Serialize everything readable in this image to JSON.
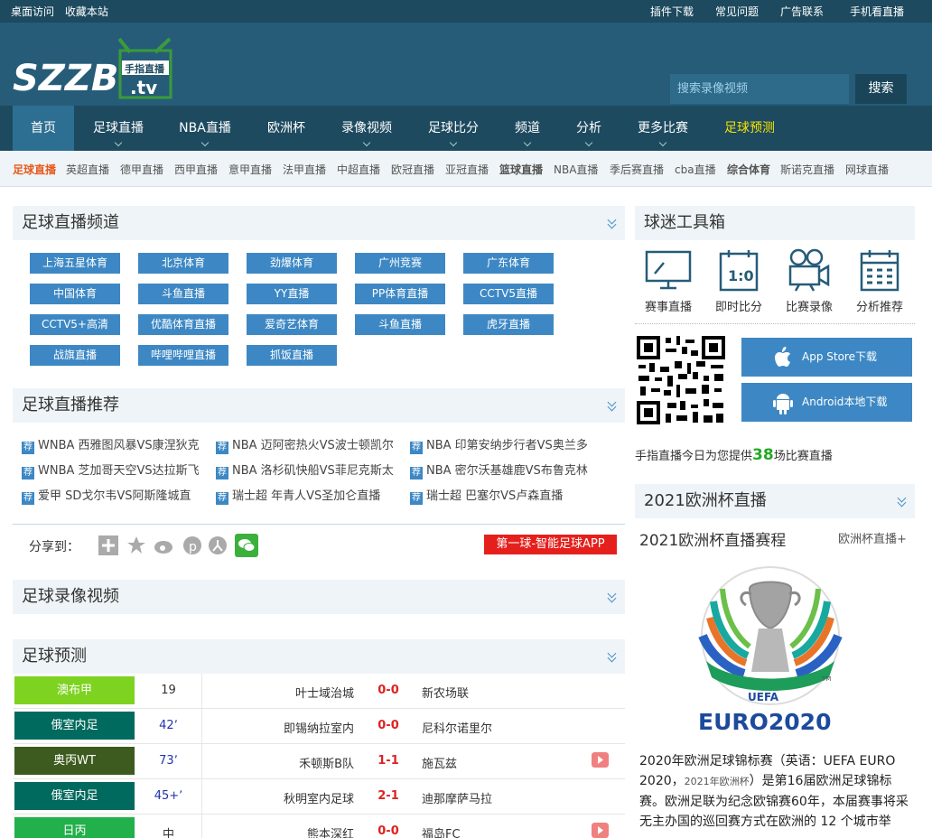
{
  "topbar": {
    "desktop": "桌面访问",
    "favorite": "收藏本站",
    "plugin": "插件下载",
    "faq": "常见问题",
    "ad": "广告联系",
    "mobile": "手机看直播"
  },
  "logo": {
    "text": "SZZB",
    "sub_cn": "手指直播",
    "sub_en": ".tv"
  },
  "search": {
    "placeholder": "搜索录像视频",
    "button": "搜索"
  },
  "nav": [
    "首页",
    "足球直播",
    "NBA直播",
    "欧洲杯",
    "录像视频",
    "足球比分",
    "频道",
    "分析",
    "更多比赛",
    "足球预测"
  ],
  "subnav": [
    "足球直播",
    "英超直播",
    "德甲直播",
    "西甲直播",
    "意甲直播",
    "法甲直播",
    "中超直播",
    "欧冠直播",
    "亚冠直播",
    "篮球直播",
    "NBA直播",
    "季后赛直播",
    "cba直播",
    "综合体育",
    "斯诺克直播",
    "网球直播"
  ],
  "channels": {
    "title": "足球直播频道",
    "items": [
      "上海五星体育",
      "北京体育",
      "劲爆体育",
      "广州竞赛",
      "广东体育",
      "中国体育",
      "斗鱼直播",
      "YY直播",
      "PP体育直播",
      "CCTV5直播",
      "CCTV5+高清",
      "优酷体育直播",
      "爱奇艺体育",
      "斗鱼直播",
      "虎牙直播",
      "战旗直播",
      "哔哩哔哩直播",
      "抓饭直播"
    ]
  },
  "recommend": {
    "title": "足球直播推荐",
    "tag": "荐",
    "items": [
      "WNBA 西雅图风暴VS康涅狄克",
      "NBA 迈阿密热火VS波士顿凯尔",
      "NBA 印第安纳步行者VS奥兰多",
      "WNBA 芝加哥天空VS达拉斯飞",
      "NBA 洛杉矶快船VS菲尼克斯太",
      "NBA 密尔沃基雄鹿VS布鲁克林",
      "爱甲 SD戈尔韦VS阿斯隆城直",
      "瑞士超 年青人VS圣加仑直播",
      "瑞士超 巴塞尔VS卢森直播"
    ]
  },
  "share": {
    "label": "分享到：",
    "app_button": "第一球-智能足球APP"
  },
  "videos": {
    "title": "足球录像视频"
  },
  "predictions": {
    "title": "足球预测",
    "rows": [
      {
        "league": "澳布甲",
        "color": "#7ed321",
        "minute": "19",
        "home": "叶士域治城",
        "score": "0-0",
        "away": "新农场联",
        "video": false
      },
      {
        "league": "俄室内足",
        "color": "#006a5e",
        "minute": "42ʼ",
        "home": "即锡纳拉室内",
        "score": "0-0",
        "away": "尼科尔诺里尔",
        "video": false
      },
      {
        "league": "奥丙WT",
        "color": "#3e5b1f",
        "minute": "73ʼ",
        "home": "禾顿斯B队",
        "score": "1-1",
        "away": "施瓦兹",
        "video": true
      },
      {
        "league": "俄室内足",
        "color": "#006a5e",
        "minute": "45+ʼ",
        "home": "秋明室内足球",
        "score": "2-1",
        "away": "迪那摩萨马拉",
        "video": false
      },
      {
        "league": "日丙",
        "color": "#22b04a",
        "minute": "中",
        "home": "熊本深红",
        "score": "0-0",
        "away": "福岛FC",
        "video": true
      }
    ]
  },
  "toolbox": {
    "title": "球迷工具箱",
    "items": [
      "赛事直播",
      "即时比分",
      "比赛录像",
      "分析推荐"
    ],
    "calendar_text": "1:0"
  },
  "apps": {
    "ios": "App Store下载",
    "android": "Android本地下载"
  },
  "today": {
    "prefix": "手指直播今日为您提供",
    "count": "38",
    "suffix": "场比赛直播"
  },
  "euro": {
    "panel_title": "2021欧洲杯直播",
    "subtitle": "2021欧洲杯直播赛程",
    "more": "欧洲杯直播+",
    "logo_uefa": "UEFA",
    "logo_tm": "TM",
    "logo_text": "EURO2020",
    "desc_1": "2020年欧洲足球锦标赛（英语：UEFA EURO 2020，",
    "desc_link": "2021年欧洲杯",
    "desc_2": "）是第16届欧洲足球锦标赛。欧洲足联为纪念欧锦赛60年，本届赛事将采无主办国的巡回赛方式在欧洲的 12 个城市举"
  }
}
